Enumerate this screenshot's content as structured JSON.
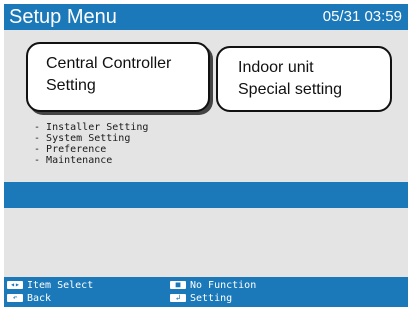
{
  "header": {
    "title": "Setup Menu",
    "datetime": "05/31 03:59"
  },
  "tiles": {
    "central": {
      "line1": "Central Controller",
      "line2": "Setting"
    },
    "indoor": {
      "line1": "Indoor unit",
      "line2": "Special setting"
    }
  },
  "menu": {
    "items": [
      "Installer Setting",
      "System Setting",
      "Preference",
      "Maintenance"
    ]
  },
  "footer": {
    "item_select": "Item Select",
    "back": "Back",
    "no_function": "No Function",
    "setting": "Setting"
  },
  "colors": {
    "accent": "#1b78b9",
    "panel": "#e4e4e4"
  },
  "icons": {
    "item_select": "left-right-arrow-icon",
    "back": "back-icon",
    "no_function": "center-button-icon",
    "setting": "enter-arrow-icon"
  }
}
